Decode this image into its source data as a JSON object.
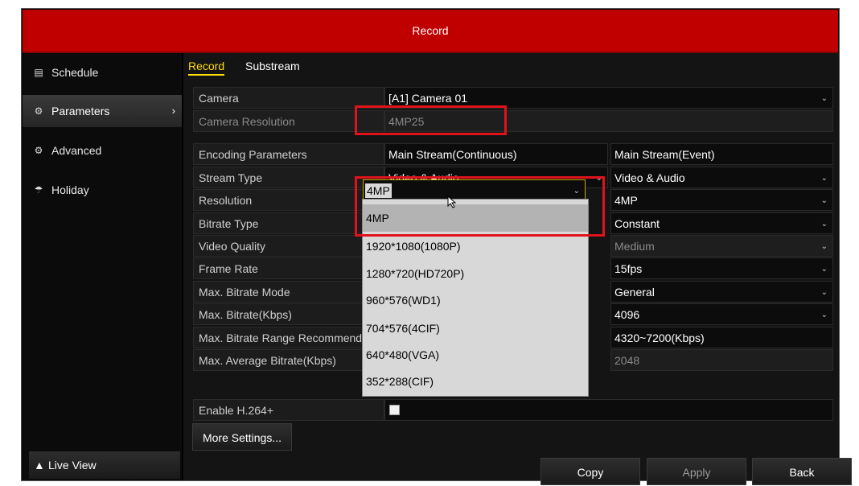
{
  "window": {
    "title": "Record"
  },
  "sidebar": {
    "items": [
      {
        "label": "Schedule",
        "icon": "calendar-icon"
      },
      {
        "label": "Parameters",
        "icon": "gear-icon"
      },
      {
        "label": "Advanced",
        "icon": "gears-icon"
      },
      {
        "label": "Holiday",
        "icon": "umbrella-icon"
      }
    ],
    "active": "Parameters",
    "live_view": {
      "label": "Live View",
      "icon": "home-icon"
    }
  },
  "tabs": [
    {
      "label": "Record",
      "active": true
    },
    {
      "label": "Substream",
      "active": false
    }
  ],
  "form": {
    "camera": {
      "label": "Camera",
      "value": "[A1] Camera 01"
    },
    "camera_resolution": {
      "label": "Camera Resolution",
      "value": "4MP25"
    },
    "encoding": {
      "label": "Encoding Parameters",
      "col_a": "Main Stream(Continuous)",
      "col_b": "Main Stream(Event)"
    },
    "stream_type": {
      "label": "Stream Type",
      "a": "Video & Audio",
      "b": "Video & Audio"
    },
    "resolution": {
      "label": "Resolution",
      "a": "4MP",
      "b": "4MP"
    },
    "bitrate_type": {
      "label": "Bitrate Type",
      "b": "Constant"
    },
    "video_quality": {
      "label": "Video Quality",
      "b": "Medium"
    },
    "frame_rate": {
      "label": "Frame Rate",
      "b": "15fps"
    },
    "max_bitrate_mode": {
      "label": "Max. Bitrate Mode",
      "b": "General"
    },
    "max_bitrate": {
      "label": "Max. Bitrate(Kbps)",
      "b": "4096"
    },
    "max_bitrate_range": {
      "label": "Max. Bitrate Range Recommend...",
      "b": "4320~7200(Kbps)"
    },
    "max_avg_bitrate": {
      "label": "Max. Average Bitrate(Kbps)",
      "b": "2048"
    },
    "h264plus": {
      "label": "Enable H.264+",
      "checked": false
    }
  },
  "resolution_dropdown": {
    "options": [
      "4MP",
      "1920*1080(1080P)",
      "1280*720(HD720P)",
      "960*576(WD1)",
      "704*576(4CIF)",
      "640*480(VGA)",
      "352*288(CIF)"
    ],
    "selected": "4MP"
  },
  "buttons": {
    "more_settings": "More Settings...",
    "copy": "Copy",
    "apply": "Apply",
    "back": "Back"
  },
  "colors": {
    "title_bar": "#c00000",
    "active_tab": "#ffdc00",
    "highlight_box": "#e0121b"
  }
}
